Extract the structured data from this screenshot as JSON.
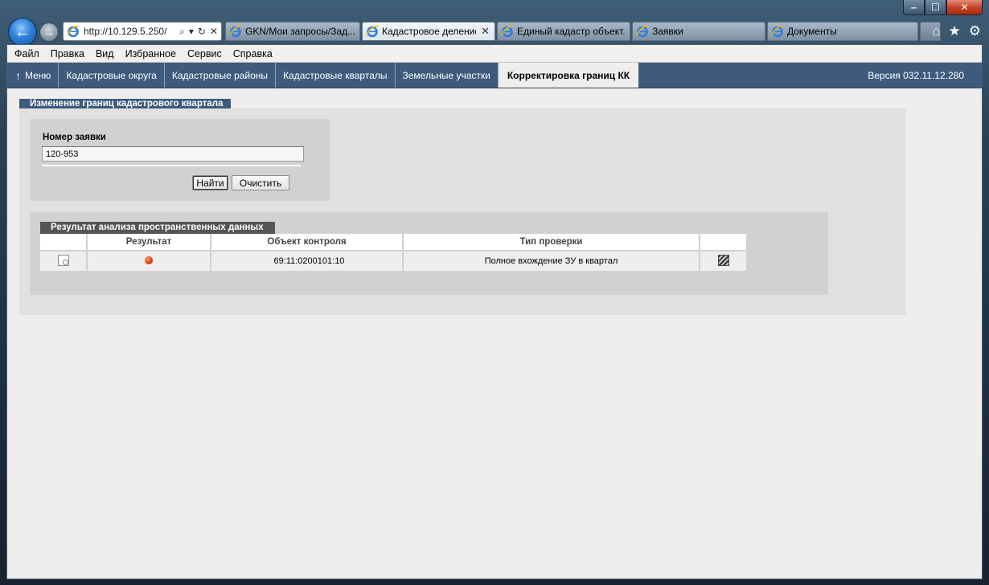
{
  "browser": {
    "url": "http://10.129.5.250/",
    "tabs": [
      {
        "label": "GKN/Мои запросы/Зад...",
        "active": false
      },
      {
        "label": "Кадастровое деление",
        "active": true
      },
      {
        "label": "Единый кадастр объект...",
        "active": false
      },
      {
        "label": "Заявки",
        "active": false
      },
      {
        "label": "Документы",
        "active": false
      }
    ]
  },
  "menubar": {
    "file": "Файл",
    "edit": "Правка",
    "view": "Вид",
    "favorites": "Избранное",
    "tools": "Сервис",
    "help": "Справка"
  },
  "appnav": {
    "menu": "Меню",
    "items": [
      "Кадастровые округа",
      "Кадастровые районы",
      "Кадастровые кварталы",
      "Земельные участки",
      "Корректировка границ КК"
    ],
    "version": "Версия 032.11.12.280"
  },
  "section": {
    "title": "Изменение границ кадастрового квартала"
  },
  "search": {
    "label": "Номер заявки",
    "value": "120-953",
    "find_label": "Найти",
    "clear_label": "Очистить"
  },
  "results": {
    "title": "Результат анализа пространственных данных",
    "columns": [
      "",
      "Результат",
      "Объект контроля",
      "Тип проверки",
      ""
    ],
    "rows": [
      {
        "status_color": "#e5350f",
        "object": "69:11:0200101:10",
        "check_type": "Полное вхождение ЗУ в квартал"
      }
    ]
  }
}
